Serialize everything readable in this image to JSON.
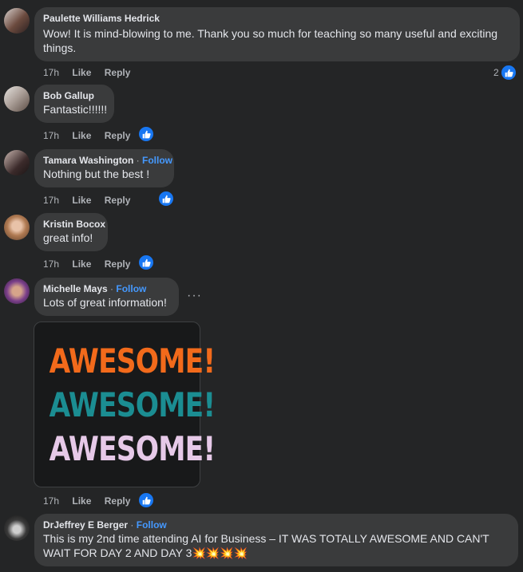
{
  "comments": [
    {
      "author": "Paulette Williams Hedrick",
      "text": "Wow! It is mind-blowing to me. Thank you so much for teaching so many useful and exciting things.",
      "time": "17h",
      "like": "Like",
      "reply": "Reply",
      "reaction_count": "2",
      "avatar_icon": "person-avatar"
    },
    {
      "author": "Bob Gallup",
      "text": "Fantastic!!!!!!",
      "time": "17h",
      "like": "Like",
      "reply": "Reply",
      "avatar_icon": "person-avatar"
    },
    {
      "author": "Tamara Washington",
      "follow": "Follow",
      "text": "Nothing but the best !",
      "time": "17h",
      "like": "Like",
      "reply": "Reply",
      "avatar_icon": "person-avatar"
    },
    {
      "author": "Kristin Bocox",
      "text": "great info!",
      "time": "17h",
      "like": "Like",
      "reply": "Reply",
      "avatar_icon": "person-avatar"
    },
    {
      "author": "Michelle Mays",
      "follow": "Follow",
      "text": "Lots of great information!",
      "time": "17h",
      "like": "Like",
      "reply": "Reply",
      "more": "···",
      "gif": {
        "line1": "AWESOME!",
        "line2": "AWESOME!",
        "line3": "AWESOME!",
        "color1": "#f26a1b",
        "color2": "#1b8d92",
        "color3": "#e6c9e8"
      },
      "avatar_icon": "person-avatar"
    },
    {
      "author": "DrJeffrey E Berger",
      "follow": "Follow",
      "text": "This is my 2nd time attending AI for Business – IT WAS TOTALLY AWESOME AND CAN'T WAIT FOR DAY 2 AND DAY 3💥💥💥💥",
      "avatar_icon": "person-avatar"
    }
  ],
  "colors": {
    "background": "#242526",
    "bubble": "#3a3b3c",
    "link_blue": "#4599ff",
    "like_blue": "#1877f2"
  }
}
